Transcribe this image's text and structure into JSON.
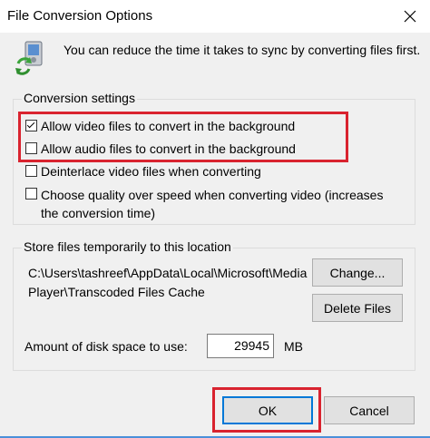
{
  "window": {
    "title": "File Conversion Options",
    "close_glyph": "✕"
  },
  "intro": {
    "icon": "sync-device-icon",
    "text": "You can reduce the time it takes to sync by converting files first."
  },
  "conversion_settings": {
    "label": "Conversion settings",
    "options": [
      {
        "label": "Allow video files to convert in the background",
        "checked": true
      },
      {
        "label": "Allow audio files to convert in the background",
        "checked": false
      },
      {
        "label": "Deinterlace video files when converting",
        "checked": false
      },
      {
        "label": "Choose quality over speed when converting video (increases the conversion time)",
        "checked": false
      }
    ]
  },
  "storage": {
    "label": "Store files temporarily to this location",
    "path": "C:\\Users\\tashreef\\AppData\\Local\\Microsoft\\Media Player\\Transcoded Files Cache",
    "change_button": "Change...",
    "delete_button": "Delete Files",
    "disk_space_label": "Amount of disk space to use:",
    "disk_space_value": "29945",
    "disk_space_unit": "MB"
  },
  "footer": {
    "ok_button": "OK",
    "cancel_button": "Cancel"
  },
  "colors": {
    "highlight": "#d9232f",
    "accent": "#0078d7"
  }
}
